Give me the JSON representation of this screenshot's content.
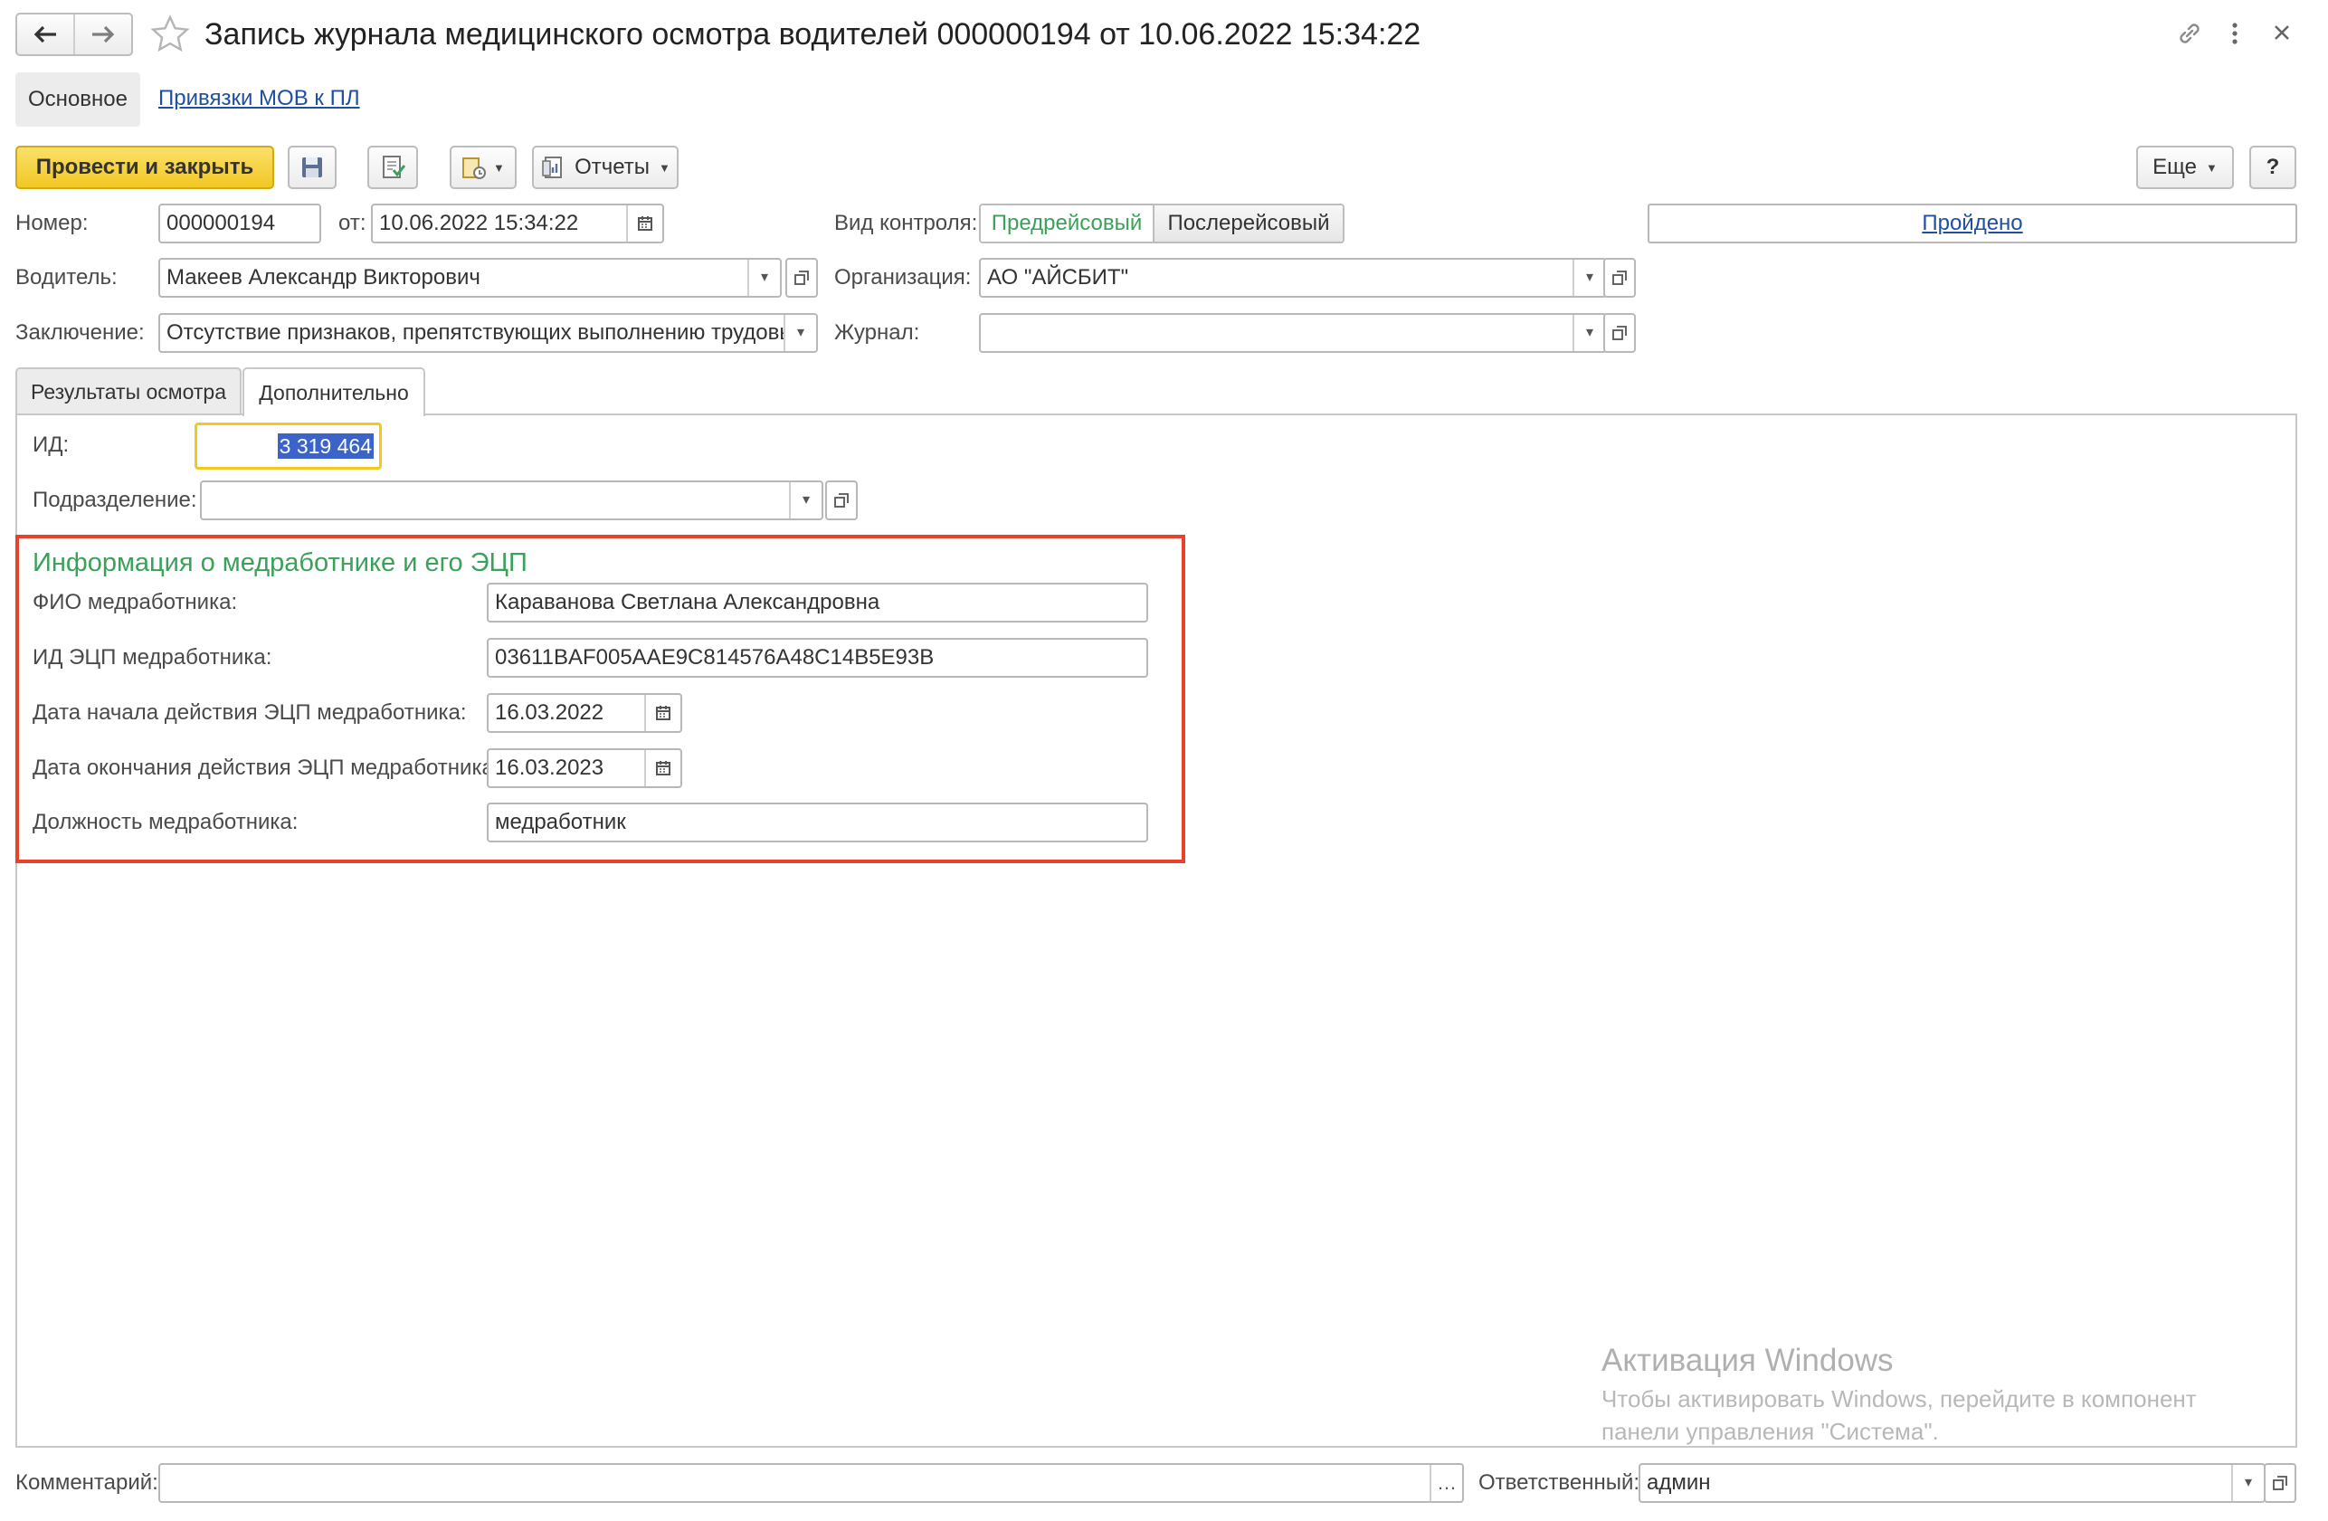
{
  "header": {
    "title": "Запись журнала медицинского осмотра водителей 000000194 от 10.06.2022 15:34:22"
  },
  "form_tabs": [
    {
      "label": "Основное"
    },
    {
      "label": "Привязки МОВ к ПЛ"
    }
  ],
  "toolbar": {
    "post_close_label": "Провести и закрыть",
    "reports_label": "Отчеты",
    "more_label": "Еще",
    "help_label": "?"
  },
  "fields": {
    "number_label": "Номер:",
    "number_value": "000000194",
    "date_label": "от:",
    "date_value": "10.06.2022 15:34:22",
    "control_label": "Вид контроля:",
    "control_options": [
      "Предрейсовый",
      "Послерейсовый"
    ],
    "status_link": "Пройдено",
    "driver_label": "Водитель:",
    "driver_value": "Макеев Александр Викторович",
    "org_label": "Организация:",
    "org_value": "АО \"АЙСБИТ\"",
    "conclusion_label": "Заключение:",
    "conclusion_value": "Отсутствие признаков, препятствующих выполнению трудовых",
    "journal_label": "Журнал:",
    "journal_value": ""
  },
  "content_tabs": [
    {
      "label": "Результаты осмотра"
    },
    {
      "label": "Дополнительно"
    }
  ],
  "additional": {
    "id_label": "ИД:",
    "id_value": "3 319 464",
    "division_label": "Подразделение:",
    "division_value": ""
  },
  "med_group": {
    "title": "Информация о медработнике и его ЭЦП",
    "fio_label": "ФИО медработника:",
    "fio_value": "Караванова Светлана Александровна",
    "ecp_id_label": "ИД ЭЦП медработника:",
    "ecp_id_value": "03611BAF005AAE9C814576A48C14B5E93B",
    "start_label": "Дата начала действия ЭЦП медработника:",
    "start_value": "16.03.2022",
    "end_label": "Дата окончания действия ЭЦП медработника:",
    "end_value": "16.03.2023",
    "position_label": "Должность медработника:",
    "position_value": "медработник"
  },
  "watermark": {
    "title": "Активация Windows",
    "line1": "Чтобы активировать Windows, перейдите в компонент",
    "line2": "панели управления \"Система\"."
  },
  "footer": {
    "comment_label": "Комментарий:",
    "comment_value": "",
    "responsible_label": "Ответственный:",
    "responsible_value": "админ"
  },
  "colors": {
    "primary_button": "#f5d234",
    "group_title": "#3aa15a",
    "highlight_frame": "#e8412c",
    "link": "#1f4fa0"
  }
}
